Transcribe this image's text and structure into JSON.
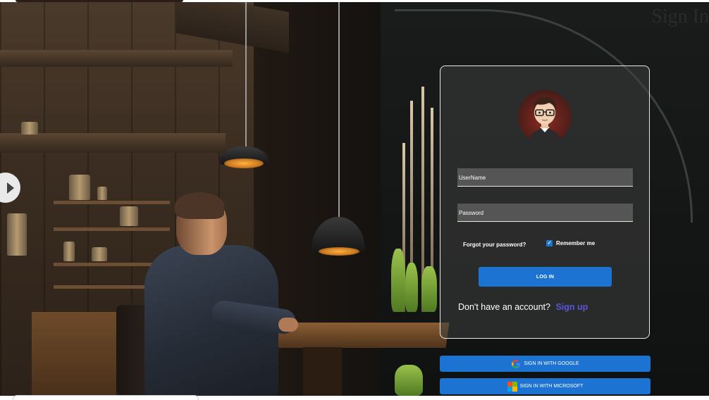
{
  "page": {
    "background_title": "Sign In"
  },
  "login_card": {
    "username_placeholder": "UserName",
    "password_placeholder": "Password",
    "forgot_password": "Forgot your password?",
    "remember_me": "Remember me",
    "remember_checked": true,
    "login_button": "LOG IN",
    "no_account_text": "Don't have an account?",
    "signup_link": "Sign up"
  },
  "social": {
    "google_label": "SIGN IN WITH GOOGLE",
    "microsoft_label": "SIGN IN WITH MICROSOFT"
  },
  "icons": {
    "carousel": "chevron-right-icon",
    "avatar": "user-avatar",
    "google": "google-icon",
    "microsoft": "microsoft-icon",
    "checkbox": "check-icon"
  },
  "colors": {
    "primary_button": "#1c73d2",
    "signup_link": "#5b55d6",
    "checkbox": "#1976d2"
  }
}
